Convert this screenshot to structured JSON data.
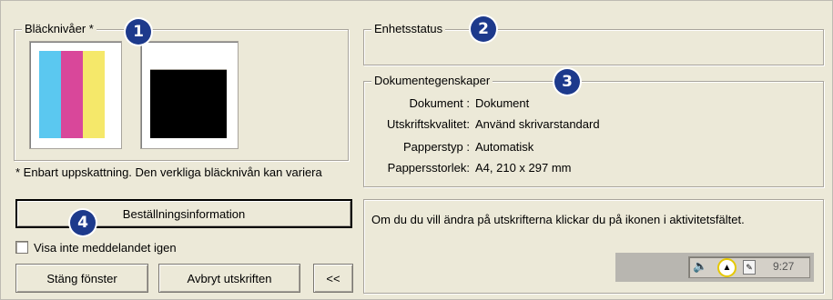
{
  "ink": {
    "title": "Bläcknivåer *",
    "tricolor_colors": [
      "#5bc8f0",
      "#d9479a",
      "#f5e86a"
    ],
    "black_level": 0.8,
    "footnote": "* Enbart uppskattning.  Den verkliga bläcknivån kan variera"
  },
  "status": {
    "title": "Enhetsstatus"
  },
  "properties": {
    "title": "Dokumentegenskaper",
    "rows": [
      {
        "label": "Dokument :",
        "value": "Dokument"
      },
      {
        "label": "Utskriftskvalitet:",
        "value": "Använd skrivarstandard"
      },
      {
        "label": "Papperstyp :",
        "value": "Automatisk"
      },
      {
        "label": "Pappersstorlek:",
        "value": "A4, 210 x 297 mm"
      }
    ]
  },
  "order_button": "Beställningsinformation",
  "dont_show_checkbox": "Visa inte meddelandet igen",
  "buttons": {
    "close": "Stäng fönster",
    "cancel": "Avbryt utskriften",
    "collapse": "<<"
  },
  "message": "Om du du vill ändra på utskrifterna klickar du på ikonen i aktivitetsfältet.",
  "tray": {
    "time": "9:27"
  },
  "callouts": [
    "1",
    "2",
    "3",
    "4"
  ]
}
